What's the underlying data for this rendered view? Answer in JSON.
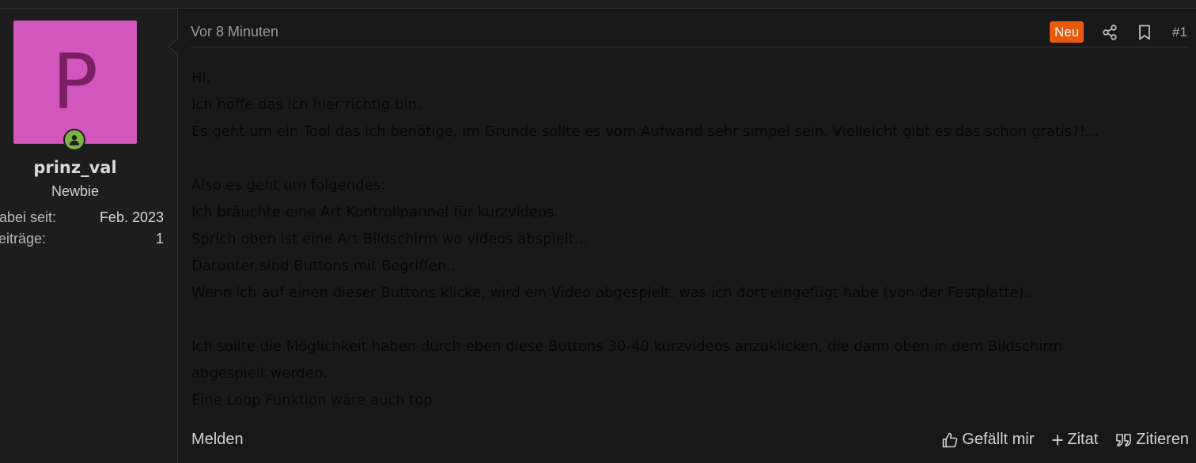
{
  "user": {
    "avatar_letter": "P",
    "avatar_color": "#d257bd",
    "name": "prinz_val",
    "title": "Newbie",
    "stats": [
      {
        "label": "Dabei seit:",
        "value": "Feb. 2023"
      },
      {
        "label": "Beiträge:",
        "value": "1"
      }
    ],
    "online_icon": "user-icon"
  },
  "message": {
    "time": "Vor 8 Minuten",
    "badge": "Neu",
    "post_number": "#1",
    "header_icons": [
      "share-icon",
      "bookmark-icon"
    ],
    "lines": [
      "Hi,",
      "Ich hoffe das ich hier richtig bin.",
      "Es geht um ein Tool das ich benötige, im Grunde sollte es vom Aufwand sehr simpel sein. Vielleicht gibt es das schon gratis?!...",
      "",
      "Also es geht um folgendes:",
      "Ich bräuchte eine Art Kontrollpannel für kurzvideos.",
      "Sprich oben ist eine Art Bildschirm wo videos abspielt...",
      "Darunter sind Buttons mit Begriffen..",
      "Wenn ich auf einen dieser Buttons klicke, wird ein Video abgespielt, was ich dort eingefügt habe (von der Festplatte)...",
      "",
      "Ich sollte die Möglichkeit haben durch eben diese Buttons 30-40 kurzvideos anzuklicken, die dann oben in dem Bildschirm",
      "abgespielt werden.",
      "Eine Loop Funktion wäre auch top"
    ]
  },
  "footer": {
    "report_label": "Melden",
    "like_label": "Gefällt mir",
    "quote_label": "Zitat",
    "reply_label": "Zitieren"
  },
  "colors": {
    "accent": "#e8590c",
    "online": "#7cb342"
  }
}
